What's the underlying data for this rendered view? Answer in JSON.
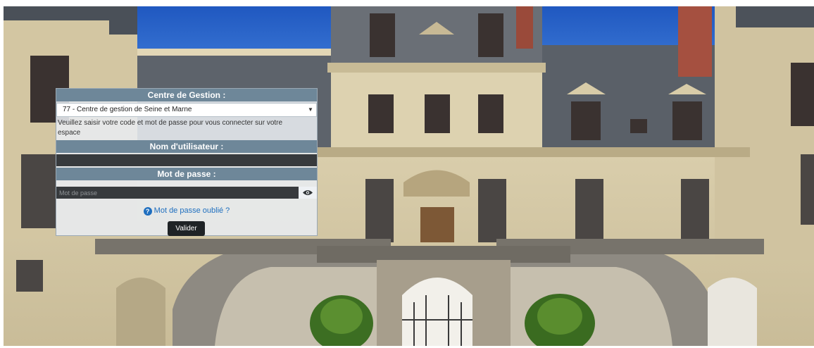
{
  "login": {
    "centre_header": "Centre de Gestion :",
    "centre_selected": "77 - Centre de gestion de Seine et Marne",
    "intro_text": "Veuillez saisir votre code et mot de passe pour vous connecter sur votre espace",
    "username_header": "Nom d'utilisateur :",
    "username_value": "",
    "password_header": "Mot de passe :",
    "password_placeholder": "Mot de passe",
    "forgot_link": "Mot de passe oublié ?",
    "submit_label": "Valider"
  },
  "icons": {
    "dropdown": "chevron-down-icon",
    "show_password": "eye-icon",
    "help": "question-circle-icon"
  },
  "colors": {
    "header_bg": "#6e8799",
    "input_bg": "#373a3d",
    "link": "#1f6fbf",
    "button_bg": "#1f2326",
    "sky": "#2a62c6"
  }
}
